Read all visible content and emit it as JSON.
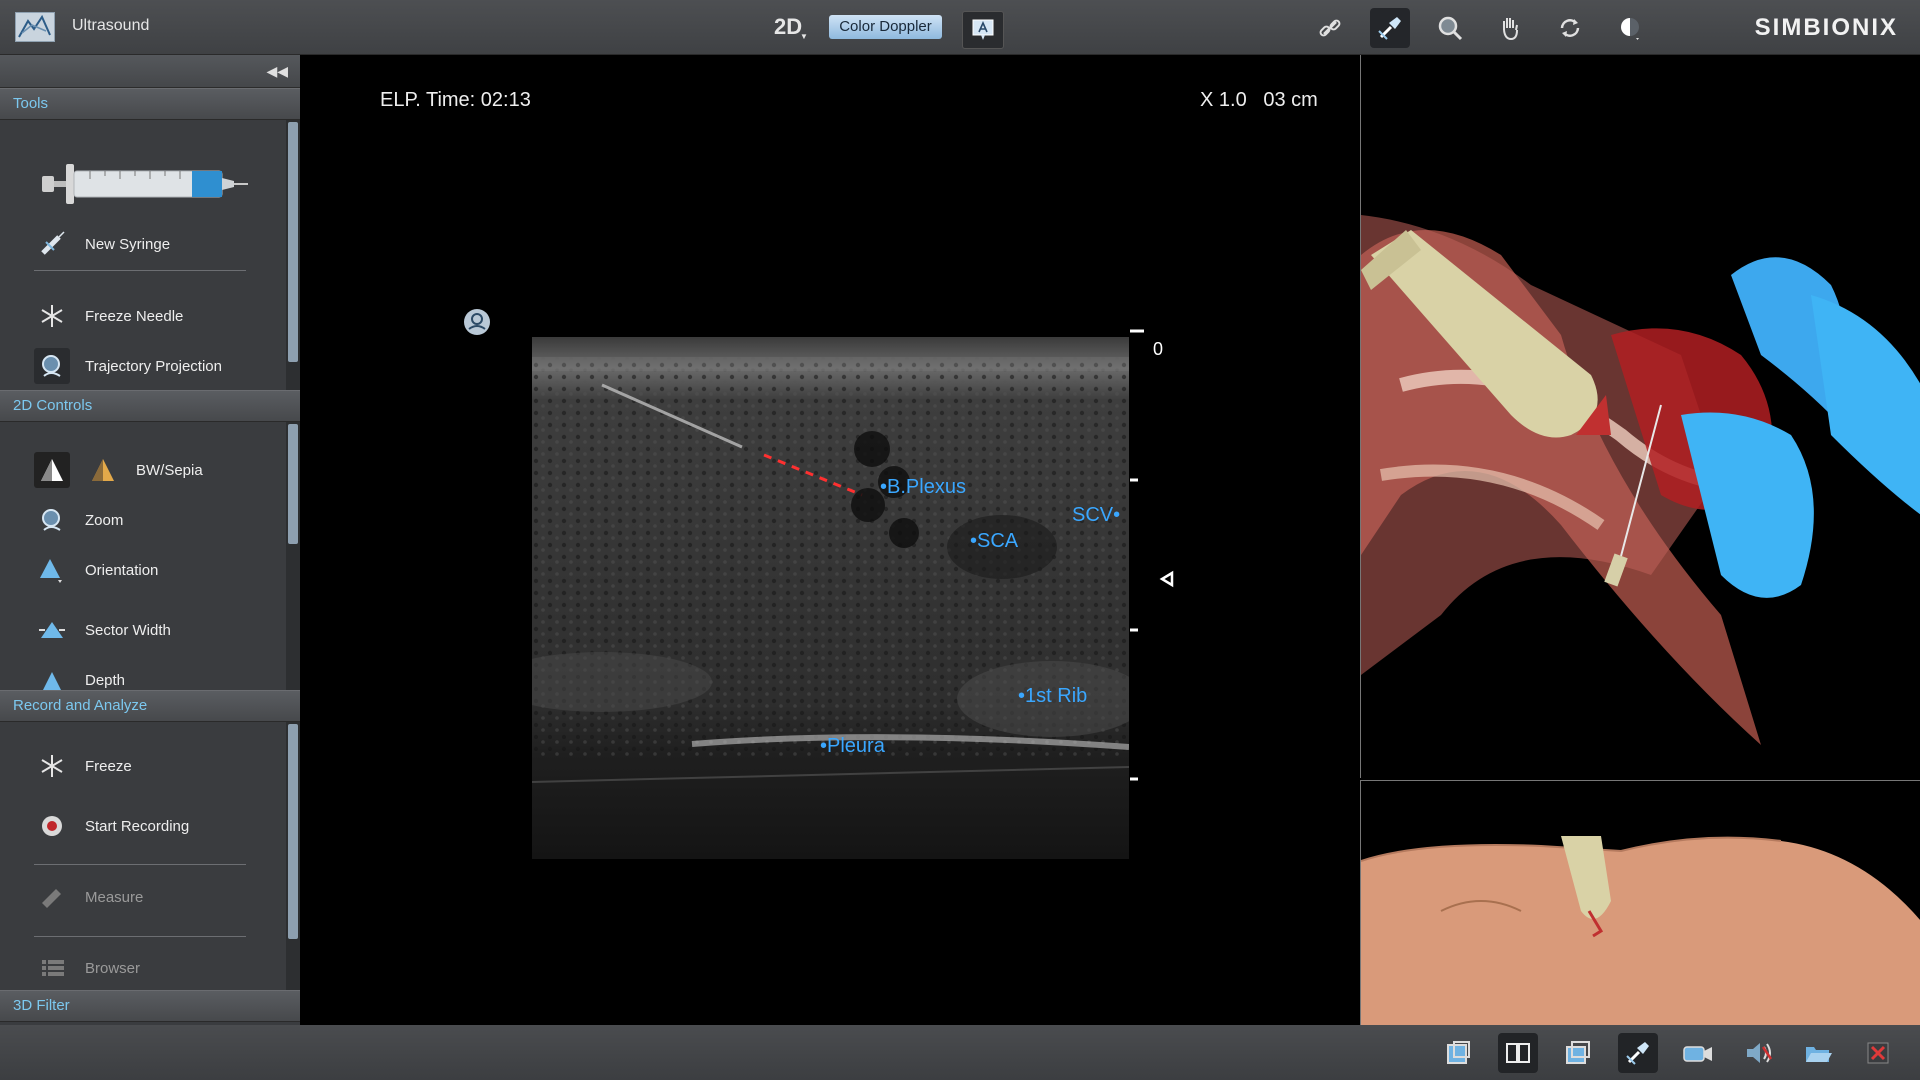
{
  "header": {
    "app_title": "Ultrasound",
    "mode_label": "2D",
    "color_doppler_label": "Color Doppler",
    "brand": "SIMBIONIX",
    "right_icons": [
      "link-icon",
      "probe-needle-icon",
      "magnifier-icon",
      "hand-icon",
      "rotate-icon",
      "light-icon"
    ]
  },
  "sidebar": {
    "sections": {
      "tools": {
        "title": "Tools",
        "items": [
          "New Syringe",
          "Freeze Needle",
          "Trajectory Projection"
        ]
      },
      "controls_2d": {
        "title": "2D Controls",
        "items": [
          "BW/Sepia",
          "Zoom",
          "Orientation",
          "Sector Width",
          "Depth"
        ]
      },
      "record": {
        "title": "Record and Analyze",
        "items": [
          "Freeze",
          "Start Recording",
          "Measure",
          "Browser"
        ]
      },
      "filter_3d": {
        "title": "3D Filter"
      }
    }
  },
  "viewport": {
    "elapsed_time": "ELP. Time: 02:13",
    "zoom": "X 1.0",
    "depth": "03 cm",
    "scale_zero": "0",
    "labels": {
      "b_plexus": "B.Plexus",
      "sca": "SCA",
      "scv": "SCV",
      "first_rib": "1st Rib",
      "pleura": "Pleura"
    }
  },
  "footer": {
    "icons": [
      "single-view-icon",
      "split-view-icon",
      "overlay-view-icon",
      "probe-tool-icon",
      "camera-icon",
      "sound-icon",
      "open-folder-icon",
      "close-icon"
    ]
  }
}
